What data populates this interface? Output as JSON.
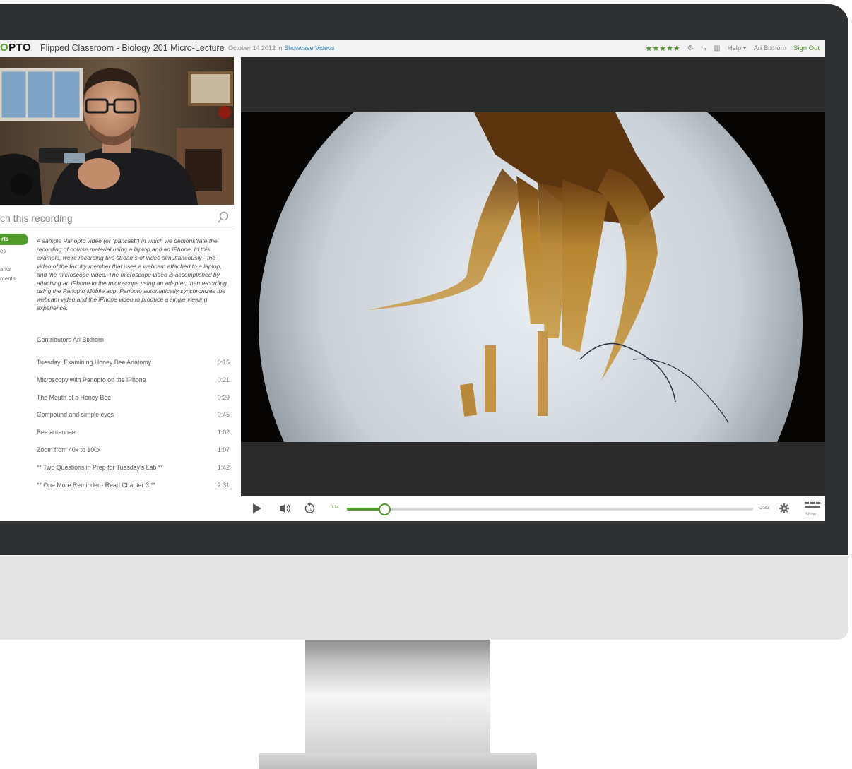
{
  "header": {
    "logo_prefix": "",
    "logo_o": "O",
    "logo_suffix": "PTO",
    "title": "Flipped Classroom - Biology 201 Micro-Lecture",
    "date": "October 14 2012 in",
    "folder": "Showcase Videos",
    "stars": "★★★★★",
    "help": "Help ▾",
    "user": "Ari Bixhorn",
    "signout": "Sign Out"
  },
  "search": {
    "placeholder": "ch this recording"
  },
  "tabs": [
    {
      "label": "rts",
      "active": true
    },
    {
      "label": "es"
    },
    {
      "label": ""
    },
    {
      "label": "arks"
    },
    {
      "label": "ments"
    }
  ],
  "description": "A sample Panopto video (or \"pancast\") in which we demonstrate the recording of course material using a laptop and an iPhone. In this example, we're recording two streams of video simultaneously - the video of the faculty member that uses a webcam attached to a laptop, and the microscope video. The microscope video is accomplished by attaching an iPhone to the microscope using an adapter, then recording using the Panopto Mobile app. Panopto automatically synchronizes the webcam video and the iPhone video to produce a single viewing experience.",
  "contributors": "Contributors Ari Bixhorn",
  "toc": [
    {
      "title": "Tuesday: Examining Honey Bee Anatomy",
      "time": "0:15"
    },
    {
      "title": "Microscopy with Panopto on the iPhone",
      "time": "0:21"
    },
    {
      "title": "The Mouth of a Honey Bee",
      "time": "0:29"
    },
    {
      "title": "Compound and simple eyes",
      "time": "0:45"
    },
    {
      "title": "Bee antennae",
      "time": "1:02"
    },
    {
      "title": "Zoom from 40x to 100x",
      "time": "1:07"
    },
    {
      "title": "** Two Questions in Prep for Tuesday's Lab **",
      "time": "1:42"
    },
    {
      "title": "** One More Reminder - Read Chapter 3 **",
      "time": "2:31"
    }
  ],
  "player": {
    "current_time": "0:14",
    "remaining_time": "-2:32",
    "progress_fraction": 0.094,
    "show_label": "Show",
    "accent_color": "#4f9a2a"
  }
}
